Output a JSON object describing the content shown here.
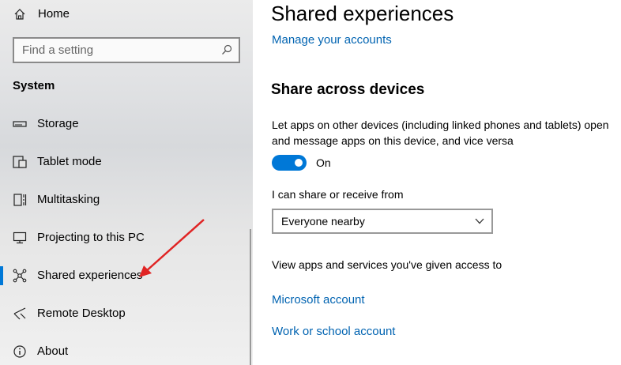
{
  "sidebar": {
    "home_label": "Home",
    "search_placeholder": "Find a setting",
    "section_title": "System",
    "items": [
      {
        "label": "Storage",
        "icon": "storage-icon"
      },
      {
        "label": "Tablet mode",
        "icon": "tablet-mode-icon"
      },
      {
        "label": "Multitasking",
        "icon": "multitasking-icon"
      },
      {
        "label": "Projecting to this PC",
        "icon": "projecting-icon"
      },
      {
        "label": "Shared experiences",
        "icon": "shared-experiences-icon",
        "active": true
      },
      {
        "label": "Remote Desktop",
        "icon": "remote-desktop-icon"
      },
      {
        "label": "About",
        "icon": "info-icon"
      }
    ]
  },
  "main": {
    "title": "Shared experiences",
    "manage_accounts_link": "Manage your accounts",
    "share_section": {
      "heading": "Share across devices",
      "description": "Let apps on other devices (including linked phones and tablets) open and message apps on this device, and vice versa",
      "toggle_state": "On",
      "toggle_on": true
    },
    "share_from": {
      "label": "I can share or receive from",
      "selected": "Everyone nearby"
    },
    "access_text": "View apps and services you've given access to",
    "links": {
      "microsoft_account": "Microsoft account",
      "work_school_account": "Work or school account"
    }
  },
  "colors": {
    "accent": "#0078d7",
    "link": "#0063b1",
    "annotation_arrow": "#e02424"
  }
}
